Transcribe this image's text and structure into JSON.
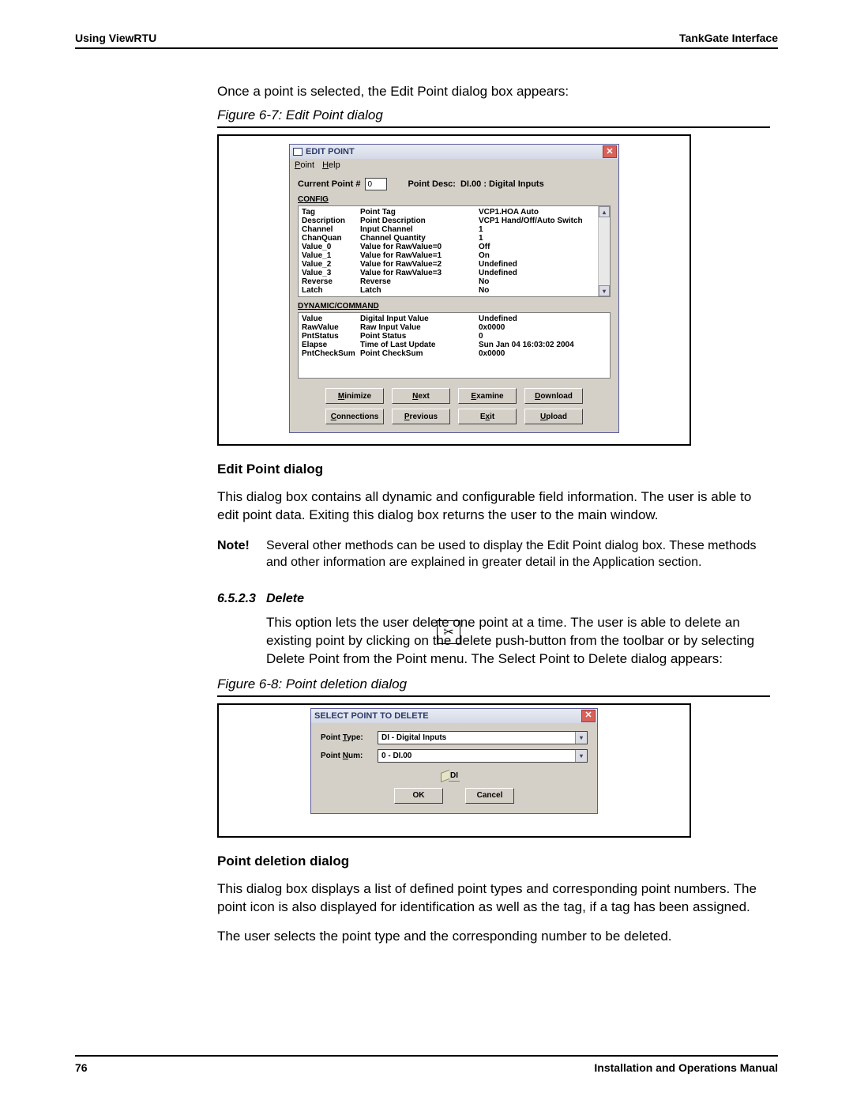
{
  "header": {
    "left": "Using ViewRTU",
    "right": "TankGate Interface"
  },
  "intro": "Once a point is selected, the Edit Point dialog box appears:",
  "fig1_caption": "Figure 6-7: Edit Point dialog",
  "edit_point": {
    "title": "EDIT POINT",
    "menu": {
      "point": "Point",
      "help": "Help"
    },
    "current_point_label": "Current Point #",
    "current_point_value": "0",
    "point_desc_label": "Point Desc:",
    "point_desc_value": "DI.00 : Digital Inputs",
    "section_config": "CONFIG",
    "config": [
      {
        "k": "Tag",
        "d": "Point Tag",
        "v": "VCP1.HOA Auto"
      },
      {
        "k": "Description",
        "d": "Point Description",
        "v": "VCP1 Hand/Off/Auto Switch"
      },
      {
        "k": "Channel",
        "d": "Input Channel",
        "v": "1"
      },
      {
        "k": "ChanQuan",
        "d": "Channel Quantity",
        "v": "1"
      },
      {
        "k": "Value_0",
        "d": "Value for RawValue=0",
        "v": "Off"
      },
      {
        "k": "Value_1",
        "d": "Value for RawValue=1",
        "v": "On"
      },
      {
        "k": "Value_2",
        "d": "Value for RawValue=2",
        "v": "Undefined"
      },
      {
        "k": "Value_3",
        "d": "Value for RawValue=3",
        "v": "Undefined"
      },
      {
        "k": "Reverse",
        "d": "Reverse",
        "v": "No"
      },
      {
        "k": "Latch",
        "d": "Latch",
        "v": "No"
      }
    ],
    "section_dyn": "DYNAMIC/COMMAND",
    "dyn": [
      {
        "k": "Value",
        "d": "Digital Input Value",
        "v": "Undefined"
      },
      {
        "k": "RawValue",
        "d": "Raw Input Value",
        "v": "0x0000"
      },
      {
        "k": "PntStatus",
        "d": "Point Status",
        "v": "0"
      },
      {
        "k": "Elapse",
        "d": "Time of Last Update",
        "v": "Sun Jan 04 16:03:02 2004"
      },
      {
        "k": "PntCheckSum",
        "d": "Point CheckSum",
        "v": "0x0000"
      }
    ],
    "buttons": {
      "minimize": "Minimize",
      "next": "Next",
      "examine": "Examine",
      "download": "Download",
      "connections": "Connections",
      "previous": "Previous",
      "exit": "Exit",
      "upload": "Upload"
    }
  },
  "body1_heading": "Edit Point dialog",
  "body1_para": "This dialog box contains all dynamic and configurable field information. The user is able to edit point data. Exiting this dialog box returns the user to the main window.",
  "note_label": "Note!",
  "note_text": "Several other methods can be used to display the Edit Point dialog box. These methods and other information are explained in greater detail in the Application section.",
  "sec_num": "6.5.2.3",
  "sec_title": "Delete",
  "delete_para": "This option lets the user delete one point at a time. The user is able to delete an existing point by clicking on the delete push-button from the toolbar or by selecting Delete Point from the Point menu. The Select Point to Delete dialog appears:",
  "fig2_caption": "Figure 6-8: Point deletion dialog",
  "delete_dialog": {
    "title": "SELECT POINT TO DELETE",
    "type_label": "Point Type:",
    "type_value": "DI - Digital Inputs",
    "num_label": "Point Num:",
    "num_value": "0 - DI.00",
    "icon_text": "DI",
    "ok": "OK",
    "cancel": "Cancel"
  },
  "body2_heading": "Point deletion dialog",
  "body2_para1": "This dialog box displays a list of defined point types and corresponding point numbers. The point icon is also displayed for identification as well as the tag, if a tag has been assigned.",
  "body2_para2": "The user selects the point type and the corresponding number to be deleted.",
  "footer": {
    "page": "76",
    "title": "Installation and Operations Manual"
  }
}
